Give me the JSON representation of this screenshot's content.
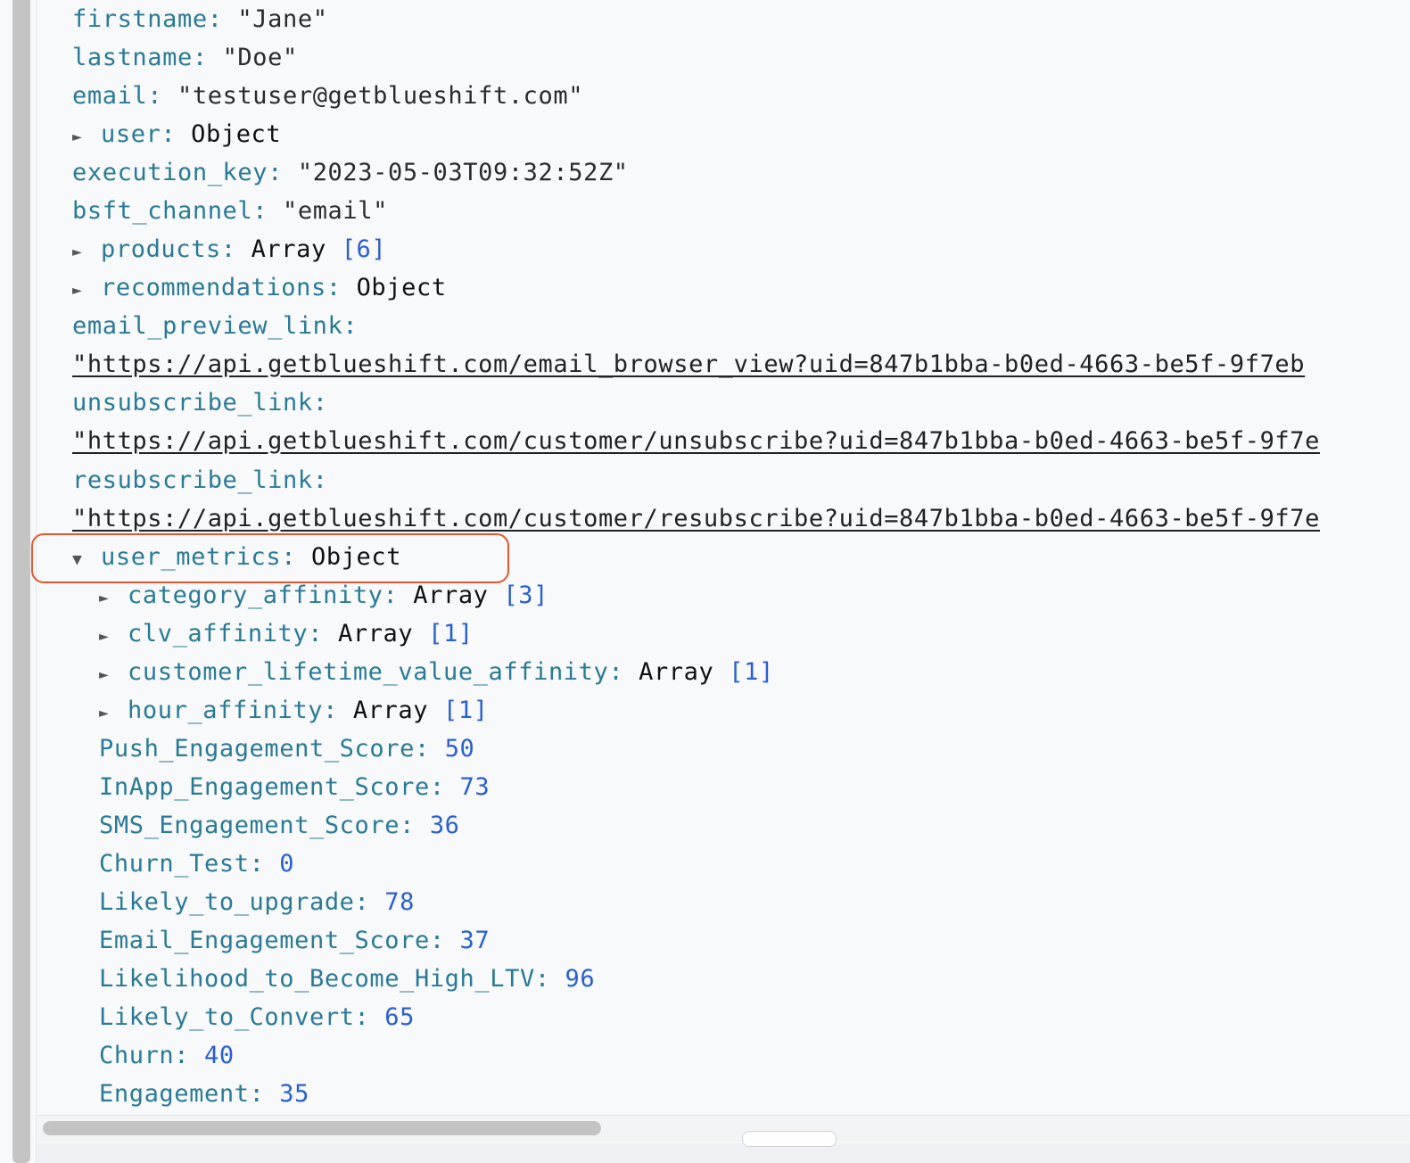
{
  "tree": {
    "firstname": {
      "key": "firstname",
      "value": "\"Jane\""
    },
    "lastname": {
      "key": "lastname",
      "value": "\"Doe\""
    },
    "email": {
      "key": "email",
      "value": "\"testuser@getblueshift.com\""
    },
    "user": {
      "key": "user",
      "type": "Object",
      "toggle": "►"
    },
    "execution_key": {
      "key": "execution_key",
      "value": "\"2023-05-03T09:32:52Z\""
    },
    "bsft_channel": {
      "key": "bsft_channel",
      "value": "\"email\""
    },
    "products": {
      "key": "products",
      "type": "Array",
      "count": "[6]",
      "toggle": "►"
    },
    "recommendations": {
      "key": "recommendations",
      "type": "Object",
      "toggle": "►"
    },
    "email_preview_link": {
      "key": "email_preview_link",
      "value": "\"https://api.getblueshift.com/email_browser_view?uid=847b1bba-b0ed-4663-be5f-9f7eb"
    },
    "unsubscribe_link": {
      "key": "unsubscribe_link",
      "value": "\"https://api.getblueshift.com/customer/unsubscribe?uid=847b1bba-b0ed-4663-be5f-9f7e"
    },
    "resubscribe_link": {
      "key": "resubscribe_link",
      "value": "\"https://api.getblueshift.com/customer/resubscribe?uid=847b1bba-b0ed-4663-be5f-9f7e"
    },
    "user_metrics": {
      "key": "user_metrics",
      "type": "Object",
      "toggle": "▼"
    },
    "category_affinity": {
      "key": "category_affinity",
      "type": "Array",
      "count": "[3]",
      "toggle": "►"
    },
    "clv_affinity": {
      "key": "clv_affinity",
      "type": "Array",
      "count": "[1]",
      "toggle": "►"
    },
    "customer_lifetime_value_affinity": {
      "key": "customer_lifetime_value_affinity",
      "type": "Array",
      "count": "[1]",
      "toggle": "►"
    },
    "hour_affinity": {
      "key": "hour_affinity",
      "type": "Array",
      "count": "[1]",
      "toggle": "►"
    },
    "push_engagement_score": {
      "key": "Push_Engagement_Score",
      "value": "50"
    },
    "inapp_engagement_score": {
      "key": "InApp_Engagement_Score",
      "value": "73"
    },
    "sms_engagement_score": {
      "key": "SMS_Engagement_Score",
      "value": "36"
    },
    "churn_test": {
      "key": "Churn_Test",
      "value": "0"
    },
    "likely_to_upgrade": {
      "key": "Likely_to_upgrade",
      "value": "78"
    },
    "email_engagement_score": {
      "key": "Email_Engagement_Score",
      "value": "37"
    },
    "likelihood_high_ltv": {
      "key": "Likelihood_to_Become_High_LTV",
      "value": "96"
    },
    "likely_to_convert": {
      "key": "Likely_to_Convert",
      "value": "65"
    },
    "churn": {
      "key": "Churn",
      "value": "40"
    },
    "engagement": {
      "key": "Engagement",
      "value": "35"
    }
  },
  "colors": {
    "key": "#2a7a97",
    "number": "#2a5fd2",
    "highlight": "#e4572e"
  },
  "icons": {
    "collapsed": "triangle-right-icon",
    "expanded": "triangle-down-icon"
  }
}
